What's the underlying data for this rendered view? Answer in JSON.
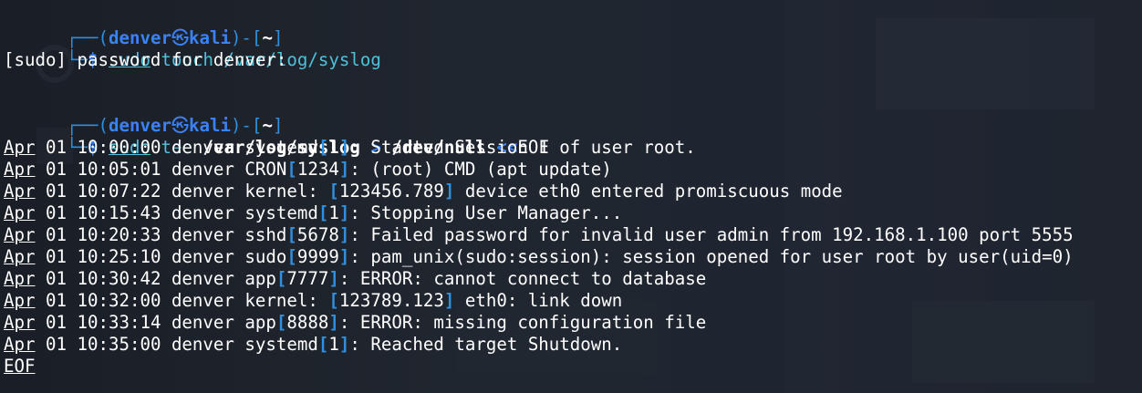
{
  "prompt1": {
    "open": "┌──(",
    "user": "denver",
    "sep_icon": "㉿",
    "host": "kali",
    "close": ")-[",
    "dir": "~",
    "end": "]",
    "corner": "└─",
    "dollar": "$",
    "cmd": "sudo",
    "args": " touch /var/log/syslog"
  },
  "sudo_prompt": "[sudo] password for denver:",
  "prompt2": {
    "open": "┌──(",
    "user": "denver",
    "sep_icon": "㉿",
    "host": "kali",
    "close": ")-[",
    "dir": "~",
    "end": "]",
    "corner": "└─",
    "dollar": "$",
    "cmd": "sudo",
    "cmd2": "tee",
    "path1": "/var/log/syslog",
    "redirect": ">",
    "path2": "/dev/null",
    "heredoc_op": "<<",
    "heredoc_word": "EOF"
  },
  "log_lines": [
    {
      "month": "Apr",
      "pre": " 01 10:00:00 denver systemd",
      "open": "[",
      "pid": "1",
      "close": "]",
      "post": ": Started Session 1 of user root."
    },
    {
      "month": "Apr",
      "pre": " 01 10:05:01 denver CRON",
      "open": "[",
      "pid": "1234",
      "close": "]",
      "post": ": (root) CMD (apt update)"
    },
    {
      "month": "Apr",
      "pre": " 01 10:07:22 denver kernel: ",
      "open": "[",
      "pid": "123456.789",
      "close": "]",
      "post": " device eth0 entered promiscuous mode"
    },
    {
      "month": "Apr",
      "pre": " 01 10:15:43 denver systemd",
      "open": "[",
      "pid": "1",
      "close": "]",
      "post": ": Stopping User Manager..."
    },
    {
      "month": "Apr",
      "pre": " 01 10:20:33 denver sshd",
      "open": "[",
      "pid": "5678",
      "close": "]",
      "post": ": Failed password for invalid user admin from 192.168.1.100 port 5555"
    },
    {
      "month": "Apr",
      "pre": " 01 10:25:10 denver sudo",
      "open": "[",
      "pid": "9999",
      "close": "]",
      "post": ": pam_unix(sudo:session): session opened for user root by user(uid=0)"
    },
    {
      "month": "Apr",
      "pre": " 01 10:30:42 denver app",
      "open": "[",
      "pid": "7777",
      "close": "]",
      "post": ": ERROR: cannot connect to database"
    },
    {
      "month": "Apr",
      "pre": " 01 10:32:00 denver kernel: ",
      "open": "[",
      "pid": "123789.123",
      "close": "]",
      "post": " eth0: link down"
    },
    {
      "month": "Apr",
      "pre": " 01 10:33:14 denver app",
      "open": "[",
      "pid": "8888",
      "close": "]",
      "post": ": ERROR: missing configuration file"
    },
    {
      "month": "Apr",
      "pre": " 01 10:35:00 denver systemd",
      "open": "[",
      "pid": "1",
      "close": "]",
      "post": ": Reached target Shutdown."
    }
  ],
  "heredoc_end": "EOF"
}
